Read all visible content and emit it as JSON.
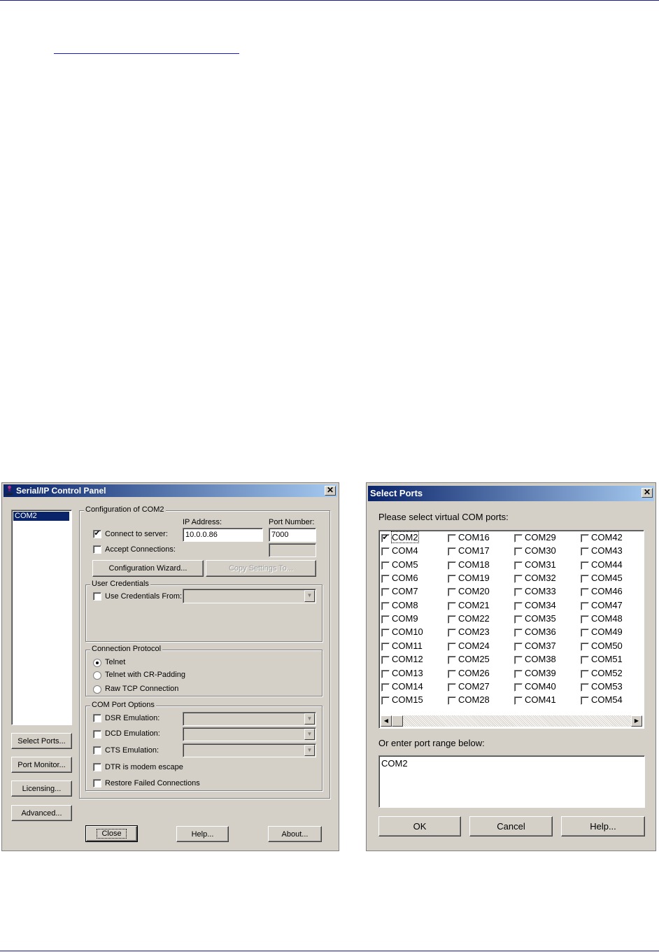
{
  "cp": {
    "title": "Serial/IP Control Panel",
    "close_glyph": "✕",
    "port_list": [
      "COM2"
    ],
    "config_group": "Configuration of COM2",
    "ip_label": "IP Address:",
    "port_label": "Port Number:",
    "connect_label": "Connect to server:",
    "connect_checked": "✔",
    "ip_value": "10.0.0.86",
    "port_value": "7000",
    "accept_label": "Accept Connections:",
    "wizard_btn": "Configuration Wizard...",
    "copy_btn": "Copy Settings To...",
    "cred_group": "User Credentials",
    "use_cred_label": "Use Credentials From:",
    "protocol_group": "Connection Protocol",
    "protocol_options": [
      "Telnet",
      "Telnet with CR-Padding",
      "Raw TCP Connection"
    ],
    "options_group": "COM Port Options",
    "dsr_label": "DSR Emulation:",
    "dcd_label": "DCD Emulation:",
    "cts_label": "CTS Emulation:",
    "dtr_label": "DTR is modem escape",
    "restore_label": "Restore Failed Connections",
    "select_ports_btn": "Select Ports...",
    "port_monitor_btn": "Port Monitor...",
    "licensing_btn": "Licensing...",
    "advanced_btn": "Advanced...",
    "close_btn": "Close",
    "help_btn": "Help...",
    "about_btn": "About..."
  },
  "sp": {
    "title": "Select Ports",
    "close_glyph": "✕",
    "prompt": "Please select virtual COM ports:",
    "ports": [
      [
        "COM2",
        "COM16",
        "COM29",
        "COM42"
      ],
      [
        "COM4",
        "COM17",
        "COM30",
        "COM43"
      ],
      [
        "COM5",
        "COM18",
        "COM31",
        "COM44"
      ],
      [
        "COM6",
        "COM19",
        "COM32",
        "COM45"
      ],
      [
        "COM7",
        "COM20",
        "COM33",
        "COM46"
      ],
      [
        "COM8",
        "COM21",
        "COM34",
        "COM47"
      ],
      [
        "COM9",
        "COM22",
        "COM35",
        "COM48"
      ],
      [
        "COM10",
        "COM23",
        "COM36",
        "COM49"
      ],
      [
        "COM11",
        "COM24",
        "COM37",
        "COM50"
      ],
      [
        "COM12",
        "COM25",
        "COM38",
        "COM51"
      ],
      [
        "COM13",
        "COM26",
        "COM39",
        "COM52"
      ],
      [
        "COM14",
        "COM27",
        "COM40",
        "COM53"
      ],
      [
        "COM15",
        "COM28",
        "COM41",
        "COM54"
      ]
    ],
    "checked_ports": [
      "COM2"
    ],
    "range_label": "Or enter port range below:",
    "range_value": "COM2",
    "ok_btn": "OK",
    "cancel_btn": "Cancel",
    "help_btn": "Help...",
    "scroll_left": "◀",
    "scroll_right": "▶"
  },
  "icons": {
    "dropdown": "▼",
    "check": "✔"
  }
}
